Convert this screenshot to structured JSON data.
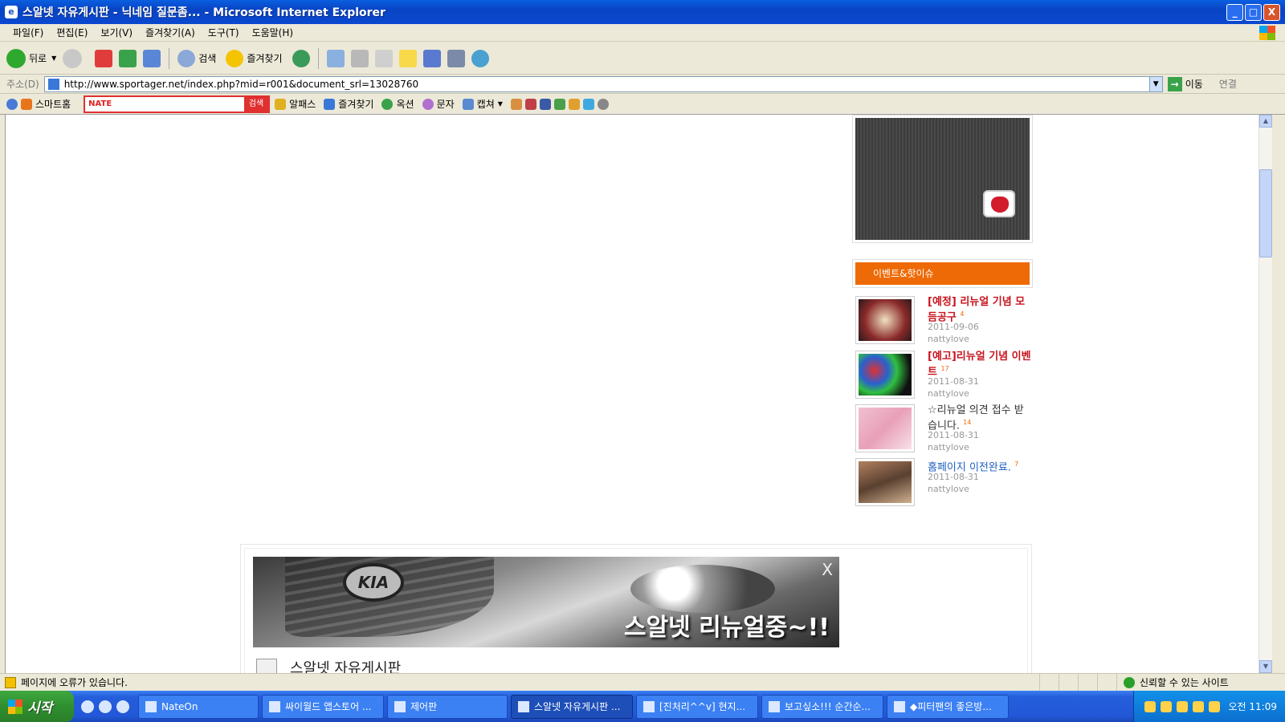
{
  "window": {
    "title": "스알넷 자유게시판 - 닉네임 질문좀... - Microsoft Internet Explorer",
    "controls": [
      "_",
      "□",
      "X"
    ]
  },
  "menu": [
    "파일(F)",
    "편집(E)",
    "보기(V)",
    "즐겨찾기(A)",
    "도구(T)",
    "도움말(H)"
  ],
  "toolbar": {
    "back_label": "뒤로",
    "search_label": "검색",
    "favorites_label": "즐겨찾기"
  },
  "address": {
    "label": "주소(D)",
    "url": "http://www.sportager.net/index.php?mid=r001&document_srl=13028760",
    "go_label": "이동",
    "links_label": "연결"
  },
  "nate": {
    "smarthome_label": "스마트홈",
    "logo": "NATE",
    "search_btn": "검색",
    "items": [
      "알패스",
      "즐겨찾기",
      "옥션",
      "문자",
      "캡쳐"
    ]
  },
  "sidebar": {
    "event_header": "이벤트&핫이슈",
    "events": [
      {
        "title": "[예정] 리뉴얼 기념 모듬공구",
        "count": "4",
        "date": "2011-09-06",
        "author": "nattylove"
      },
      {
        "title": "[예고]리뉴얼 기념 이벤트",
        "count": "17",
        "date": "2011-08-31",
        "author": "nattylove"
      },
      {
        "title": "☆리뉴얼 의견 접수 받습니다.",
        "count": "14",
        "date": "2011-08-31",
        "author": "nattylove"
      },
      {
        "title": "홈페이지 이전완료.",
        "count": "7",
        "date": "2011-08-31",
        "author": "nattylove"
      }
    ]
  },
  "banner": {
    "message": "스알넷 리뉴얼중~!!",
    "brand": "KIA",
    "close": "X"
  },
  "board": {
    "title": "스알넷 자유게시판"
  },
  "statusbar": {
    "message": "페이지에 오류가 있습니다.",
    "zone": "신뢰할 수 있는 사이트"
  },
  "taskbar": {
    "start_label": "시작",
    "tasks": [
      "NateOn",
      "싸이월드 앱스토어 ...",
      "제어판",
      "스알넷 자유게시판 ...",
      "[진처리^^v] 현지...",
      "보고싶소!!! 순간순...",
      "◆피터팬의 좋은방..."
    ],
    "clock": "오전 11:09"
  }
}
